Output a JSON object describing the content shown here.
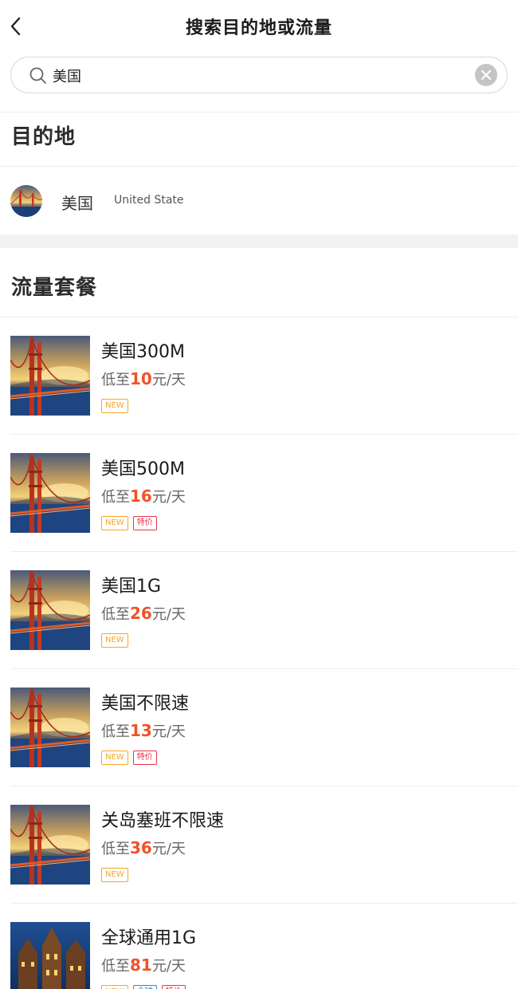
{
  "header": {
    "title": "搜索目的地或流量"
  },
  "search": {
    "value": "美国",
    "placeholder": ""
  },
  "sections": {
    "destinations": "目的地",
    "plans": "流量套餐"
  },
  "destination": {
    "name": "美国",
    "english": "United State"
  },
  "price_prefix": "低至",
  "price_suffix": "元/天",
  "plans": [
    {
      "name": "美国300M",
      "price": "10",
      "tags": [
        "NEW"
      ]
    },
    {
      "name": "美国500M",
      "price": "16",
      "tags": [
        "NEW",
        "特价"
      ]
    },
    {
      "name": "美国1G",
      "price": "26",
      "tags": [
        "NEW"
      ]
    },
    {
      "name": "美国不限速",
      "price": "13",
      "tags": [
        "NEW",
        "特价"
      ]
    },
    {
      "name": "关岛塞班不限速",
      "price": "36",
      "tags": [
        "NEW"
      ]
    },
    {
      "name": "全球通用1G",
      "price": "81",
      "tags": [
        "NEW",
        "全球",
        "特价"
      ]
    }
  ],
  "colors": {
    "price": "#f0522a",
    "tag_new": "#f5a623",
    "tag_sale": "#e8344a",
    "tag_global": "#2f86e0"
  }
}
